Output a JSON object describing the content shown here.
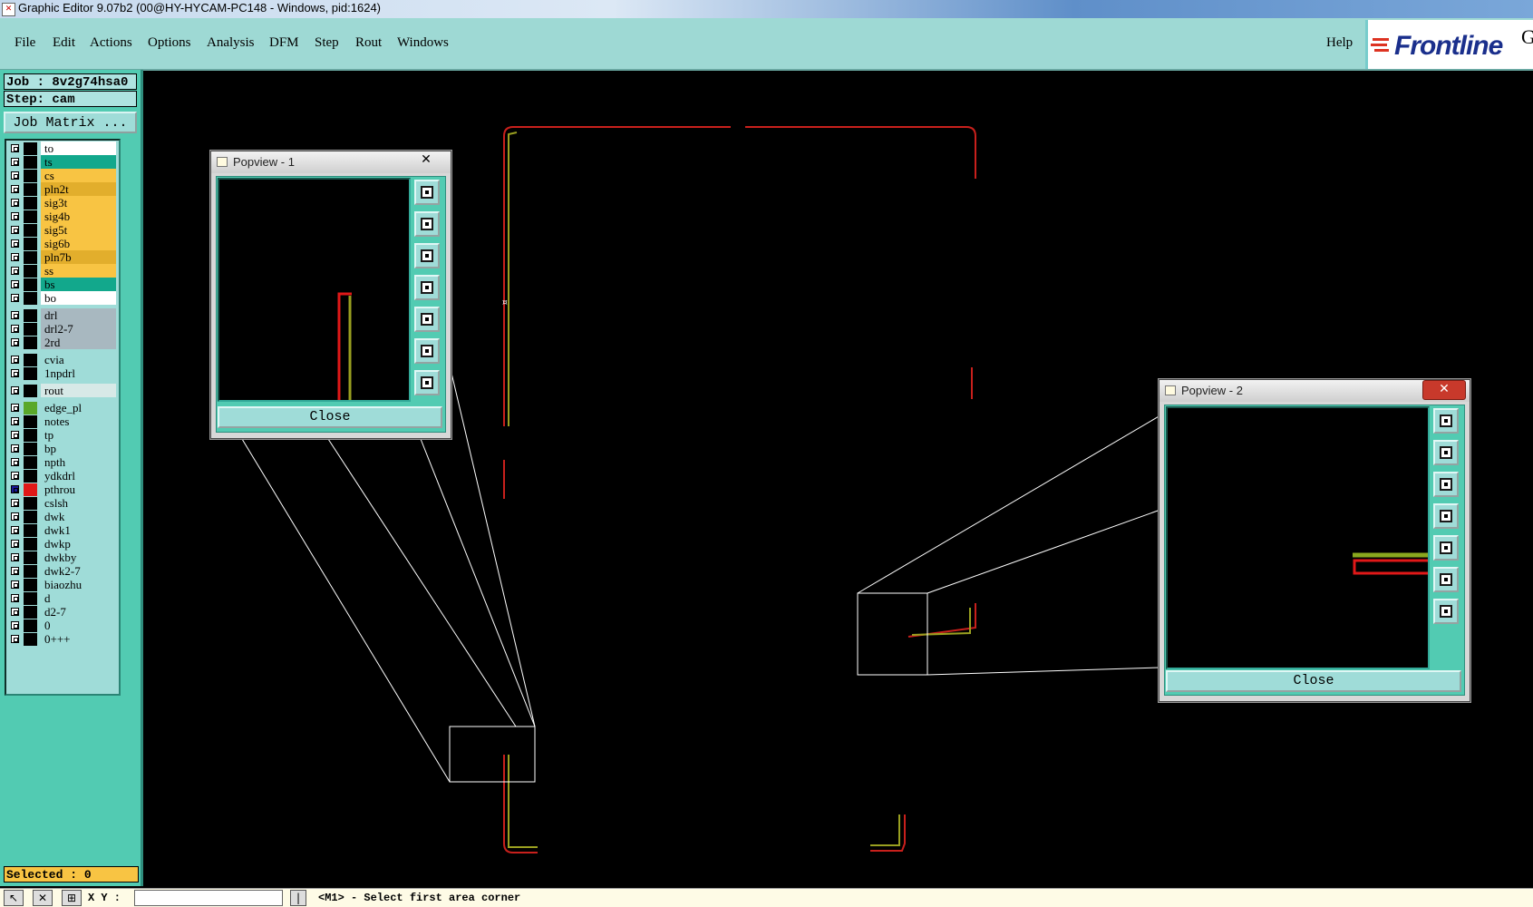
{
  "window": {
    "title": "Graphic Editor 9.07b2 (00@HY-HYCAM-PC148 - Windows, pid:1624)"
  },
  "menu": {
    "items": [
      "File",
      "Edit",
      "Actions",
      "Options",
      "Analysis",
      "DFM",
      "Step",
      "Rout",
      "Windows"
    ],
    "help": "Help"
  },
  "logo": {
    "text": "Frontline",
    "suffix": "G"
  },
  "job": {
    "label": "Job : 8v2g74hsa0",
    "step": "Step: cam"
  },
  "job_matrix_button": "Job Matrix ...",
  "layers": [
    {
      "name": "to",
      "color": "#ffffff"
    },
    {
      "name": "ts",
      "color": "#12a88c"
    },
    {
      "name": "cs",
      "color": "#f8c443"
    },
    {
      "name": "pln2t",
      "color": "#e2ae2c"
    },
    {
      "name": "sig3t",
      "color": "#f8c443"
    },
    {
      "name": "sig4b",
      "color": "#f8c443"
    },
    {
      "name": "sig5t",
      "color": "#f8c443"
    },
    {
      "name": "sig6b",
      "color": "#f8c443"
    },
    {
      "name": "pln7b",
      "color": "#e2ae2c"
    },
    {
      "name": "ss",
      "color": "#f8c443"
    },
    {
      "name": "bs",
      "color": "#12a88c"
    },
    {
      "name": "bo",
      "color": "#ffffff"
    },
    {
      "name": "drl",
      "color": "#a8b8c0"
    },
    {
      "name": "drl2-7",
      "color": "#a8b8c0"
    },
    {
      "name": "2rd",
      "color": "#a8b8c0"
    },
    {
      "name": "cvia",
      "color": "#9fdcd8"
    },
    {
      "name": "1npdrl",
      "color": "#9fdcd8"
    },
    {
      "name": "rout",
      "color": "#d7e9e7"
    },
    {
      "name": "edge_pl",
      "color": "#9fdcd8"
    },
    {
      "name": "notes",
      "color": "#9fdcd8"
    },
    {
      "name": "tp",
      "color": "#9fdcd8"
    },
    {
      "name": "bp",
      "color": "#9fdcd8"
    },
    {
      "name": "npth",
      "color": "#9fdcd8"
    },
    {
      "name": "ydkdrl",
      "color": "#9fdcd8"
    },
    {
      "name": "pthrou",
      "color": "#9fdcd8"
    },
    {
      "name": "cslsh",
      "color": "#9fdcd8"
    },
    {
      "name": "dwk",
      "color": "#9fdcd8"
    },
    {
      "name": "dwk1",
      "color": "#9fdcd8"
    },
    {
      "name": "dwkp",
      "color": "#9fdcd8"
    },
    {
      "name": "dwkby",
      "color": "#9fdcd8"
    },
    {
      "name": "dwk2-7",
      "color": "#9fdcd8"
    },
    {
      "name": "biaozhu",
      "color": "#9fdcd8"
    },
    {
      "name": "d",
      "color": "#9fdcd8"
    },
    {
      "name": "d2-7",
      "color": "#9fdcd8"
    },
    {
      "name": "0",
      "color": "#9fdcd8"
    },
    {
      "name": "0+++",
      "color": "#9fdcd8"
    }
  ],
  "selected": "Selected : 0",
  "status": {
    "xy_label": "X Y :",
    "xy_value": "",
    "prompt": "<M1> - Select first area corner"
  },
  "popview1": {
    "title": "Popview - 1",
    "close": "Close"
  },
  "popview2": {
    "title": "Popview - 2",
    "close": "Close"
  }
}
